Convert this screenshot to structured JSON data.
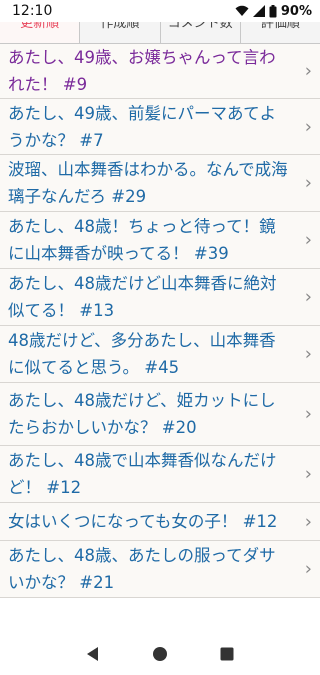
{
  "status": {
    "time": "12:10",
    "battery": "90%"
  },
  "tabs": [
    {
      "label": "更新順",
      "active": true
    },
    {
      "label": "作成順",
      "active": false
    },
    {
      "label": "コメント数",
      "active": false
    },
    {
      "label": "評価順",
      "active": false
    }
  ],
  "items": [
    {
      "title": "あたし、49歳、お嬢ちゃんって言われた！ #9",
      "visited": true
    },
    {
      "title": "あたし、49歳、前髪にパーマあてようかな？ #7",
      "visited": false
    },
    {
      "title": "波瑠、山本舞香はわかる。なんで成海璃子なんだろ #29",
      "visited": false
    },
    {
      "title": "あたし、48歳！ちょっと待って！鏡に山本舞香が映ってる！ #39",
      "visited": false
    },
    {
      "title": "あたし、48歳だけど山本舞香に絶対似てる！ #13",
      "visited": false
    },
    {
      "title": "48歳だけど、多分あたし、山本舞香に似てると思う。 #45",
      "visited": false
    },
    {
      "title": "あたし、48歳だけど、姫カットにしたらおかしいかな？ #20",
      "visited": false
    },
    {
      "title": "あたし、48歳で山本舞香似なんだけど！ #12",
      "visited": false
    },
    {
      "title": "女はいくつになっても女の子！ #12",
      "visited": false
    },
    {
      "title": "あたし、48歳、あたしの服ってダサいかな？ #21",
      "visited": false
    }
  ],
  "colors": {
    "link": "#1f6aa6",
    "visited": "#7a2a9a",
    "active_tab": "#e8455c"
  },
  "icons": {
    "back": "back-triangle-icon",
    "home": "home-circle-icon",
    "recents": "recents-square-icon",
    "chevron": "chevron-right-icon"
  }
}
